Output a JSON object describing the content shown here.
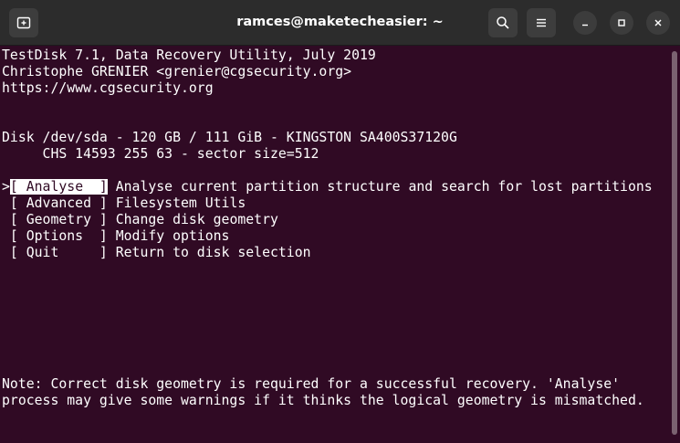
{
  "window": {
    "title": "ramces@maketecheasier: ~"
  },
  "icons": {
    "new_tab": "new-tab-icon",
    "search": "search-icon",
    "menu": "hamburger-menu-icon",
    "minimize": "minimize-icon",
    "maximize": "maximize-icon",
    "close": "close-icon"
  },
  "terminal": {
    "header": [
      "TestDisk 7.1, Data Recovery Utility, July 2019",
      "Christophe GRENIER <grenier@cgsecurity.org>",
      "https://www.cgsecurity.org"
    ],
    "disk_line": "Disk /dev/sda - 120 GB / 111 GiB - KINGSTON SA400S37120G",
    "chs_line": "     CHS 14593 255 63 - sector size=512",
    "selected_prefix": ">",
    "menu": [
      {
        "button": "[ Analyse  ]",
        "description": " Analyse current partition structure and search for lost partitions"
      },
      {
        "button": " [ Advanced ]",
        "description": " Filesystem Utils"
      },
      {
        "button": " [ Geometry ]",
        "description": " Change disk geometry"
      },
      {
        "button": " [ Options  ]",
        "description": " Modify options"
      },
      {
        "button": " [ Quit     ]",
        "description": " Return to disk selection"
      }
    ],
    "note": [
      "Note: Correct disk geometry is required for a successful recovery. 'Analyse'",
      "process may give some warnings if it thinks the logical geometry is mismatched."
    ]
  },
  "colors": {
    "terminal_bg": "#300a24",
    "titlebar_bg": "#2c2c2c",
    "text": "#ffffff"
  }
}
